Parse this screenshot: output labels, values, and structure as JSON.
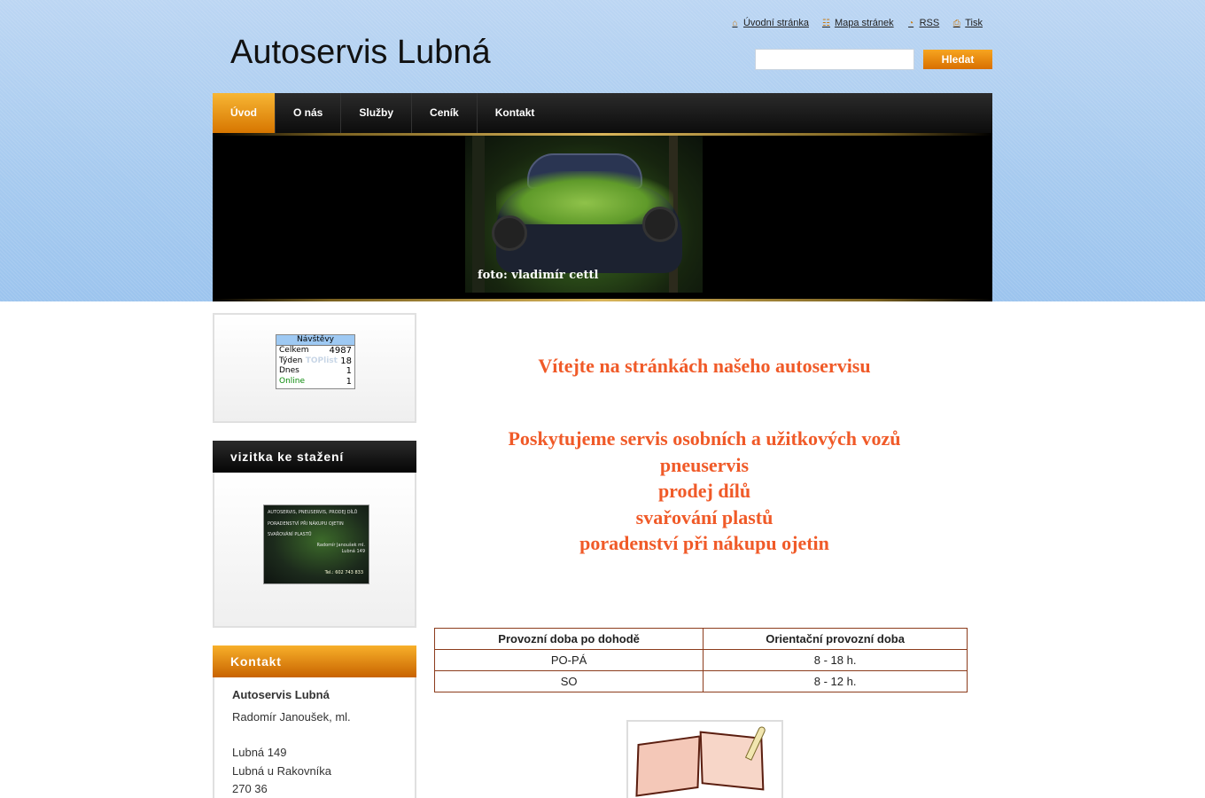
{
  "site": {
    "title": "Autoservis Lubná"
  },
  "quicklinks": [
    {
      "label": "Úvodní stránka",
      "icon": "home-icon"
    },
    {
      "label": "Mapa stránek",
      "icon": "sitemap-icon"
    },
    {
      "label": "RSS",
      "icon": "rss-icon"
    },
    {
      "label": "Tisk",
      "icon": "print-icon"
    }
  ],
  "search": {
    "value": "",
    "button_label": "Hledat"
  },
  "nav": {
    "items": [
      "Úvod",
      "O nás",
      "Služby",
      "Ceník",
      "Kontakt"
    ],
    "active": "Úvod"
  },
  "banner": {
    "caption": "foto: vladimír cettl"
  },
  "counter": {
    "title": "Návštěvy",
    "watermark": "TOPlist",
    "rows": [
      {
        "label": "Celkem",
        "value": "4987"
      },
      {
        "label": "Týden",
        "value": "18"
      },
      {
        "label": "Dnes",
        "value": "1"
      },
      {
        "label": "Online",
        "value": "1"
      }
    ]
  },
  "vizitka": {
    "heading": "vizitka ke stažení",
    "card_lines": [
      "AUTOSERVIS, PNEUSERVIS, PRODEJ DÍLŮ",
      "PORADENSTVÍ PŘI NÁKUPU OJETIN",
      "SVAŘOVÁNÍ PLASTŮ",
      "Radomír Janoušek ml.",
      "Lubná 149"
    ],
    "card_phone": "Tel.: 602 743 833"
  },
  "contact": {
    "heading": "Kontakt",
    "name": "Autoservis Lubná",
    "person": "Radomír Janoušek, ml.",
    "street": "Lubná 149",
    "city": "Lubná u Rakovníka",
    "zip": "270 36"
  },
  "main": {
    "welcome": "Vítejte na stránkách našeho autoservisu",
    "services": [
      "Poskytujeme servis osobních a užitkových vozů",
      "pneuservis",
      "prodej dílů",
      "svařování plastů",
      "poradenství při nákupu ojetin"
    ],
    "hours_table": {
      "headers": [
        "Provozní doba po dohodě",
        "Orientační provozní doba"
      ],
      "rows": [
        [
          "PO-PÁ",
          "8 - 18 h."
        ],
        [
          "SO",
          "8 - 12 h."
        ]
      ]
    }
  },
  "colors": {
    "accent_orange": "#f05a28",
    "nav_active": "#e68a10",
    "sky_blue": "#a6caef"
  }
}
